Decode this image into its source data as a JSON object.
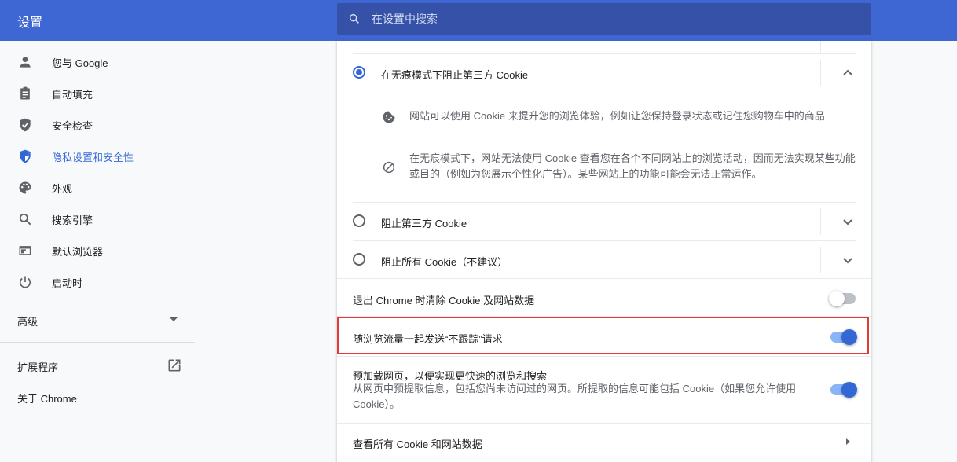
{
  "header": {
    "title": "设置",
    "search_placeholder": "在设置中搜索"
  },
  "sidebar": {
    "items": [
      {
        "label": "您与 Google",
        "icon": "person-icon"
      },
      {
        "label": "自动填充",
        "icon": "clipboard-icon"
      },
      {
        "label": "安全检查",
        "icon": "shield-check-icon"
      },
      {
        "label": "隐私设置和安全性",
        "icon": "shield-icon",
        "active": true
      },
      {
        "label": "外观",
        "icon": "palette-icon"
      },
      {
        "label": "搜索引擎",
        "icon": "search-icon"
      },
      {
        "label": "默认浏览器",
        "icon": "browser-icon"
      },
      {
        "label": "启动时",
        "icon": "power-icon"
      }
    ],
    "advanced": "高级",
    "extensions": "扩展程序",
    "about": "关于 Chrome"
  },
  "cookies": {
    "option_incognito": "在无痕模式下阻止第三方 Cookie",
    "detail_cookie": "网站可以使用 Cookie 来提升您的浏览体验，例如让您保持登录状态或记住您购物车中的商品",
    "detail_block": "在无痕模式下，网站无法使用 Cookie 查看您在各个不同网站上的浏览活动，因而无法实现某些功能或目的（例如为您展示个性化广告）。某些网站上的功能可能会无法正常运作。",
    "option_third_party": "阻止第三方 Cookie",
    "option_all": "阻止所有 Cookie（不建议）"
  },
  "settings": {
    "clear_on_exit": "退出 Chrome 时清除 Cookie 及网站数据",
    "do_not_track": "随浏览流量一起发送“不跟踪”请求",
    "preload_title": "预加载网页，以便实现更快速的浏览和搜索",
    "preload_desc": "从网页中预提取信息，包括您尚未访问过的网页。所提取的信息可能包括 Cookie（如果您允许使用 Cookie）。",
    "see_all": "查看所有 Cookie 和网站数据"
  },
  "colors": {
    "header": "#3f67d3",
    "accent": "#3367d6",
    "highlight": "#e53935"
  }
}
